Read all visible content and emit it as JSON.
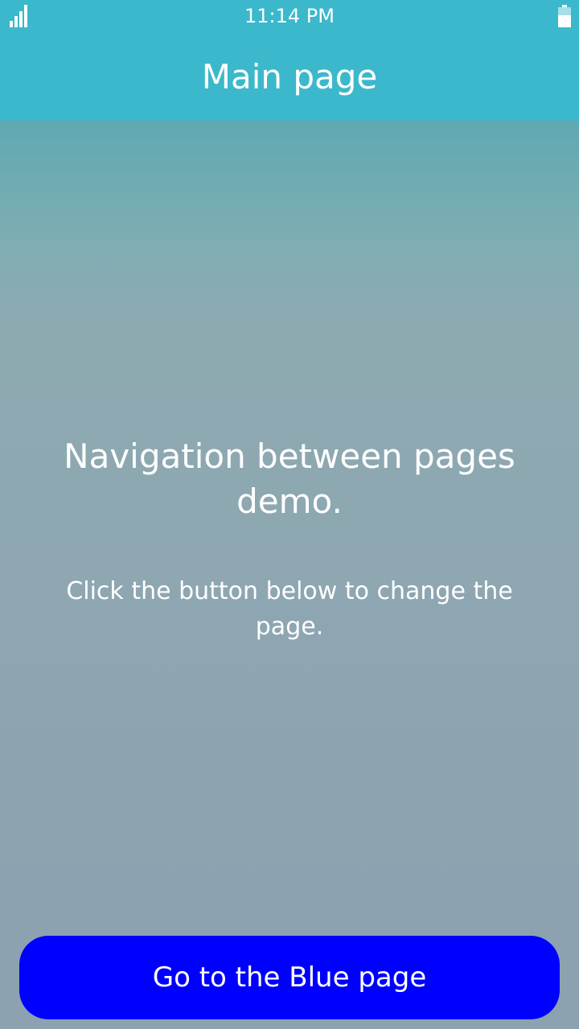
{
  "status_bar": {
    "time": "11:14 PM",
    "signal_icon": "signal-bars-icon",
    "battery_icon": "battery-icon"
  },
  "header": {
    "title": "Main page"
  },
  "content": {
    "heading": "Navigation between pages demo.",
    "body": "Click the button below to change the page."
  },
  "actions": {
    "button_label": "Go to the Blue page"
  },
  "colors": {
    "header_background": "#3bb8cc",
    "button_background": "#0000ff",
    "text": "#ffffff"
  }
}
